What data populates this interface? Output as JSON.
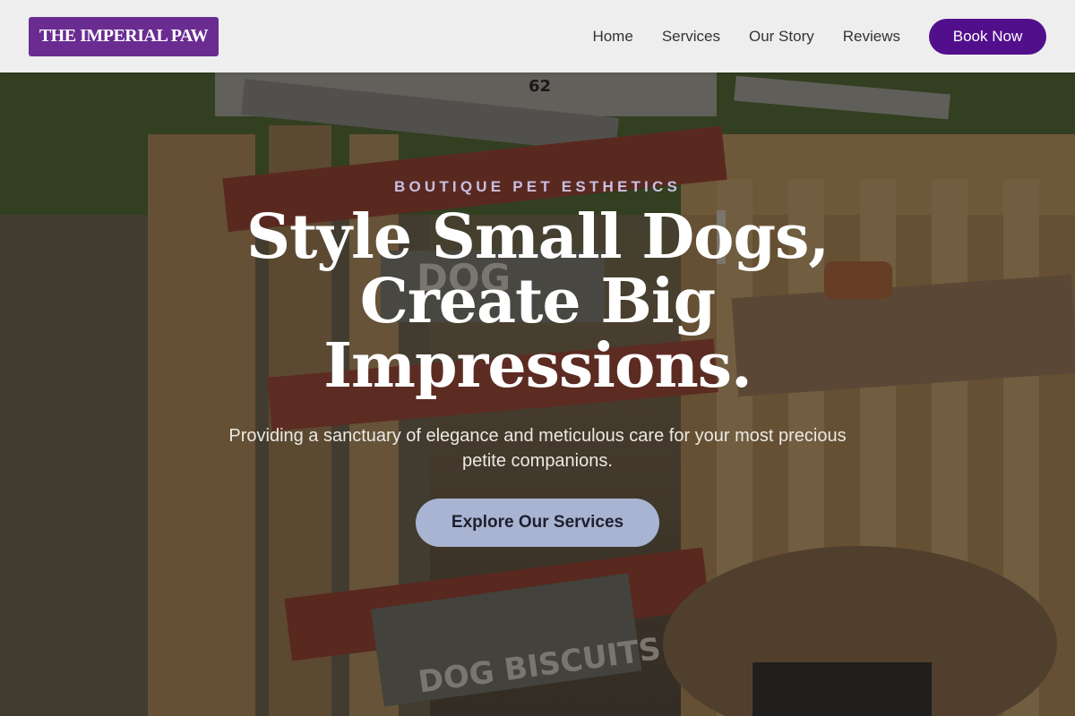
{
  "brand": {
    "logo_text": "THE IMPERIAL PAW"
  },
  "nav": {
    "items": [
      {
        "label": "Home"
      },
      {
        "label": "Services"
      },
      {
        "label": "Our Story"
      },
      {
        "label": "Reviews"
      }
    ],
    "cta_label": "Book Now"
  },
  "hero": {
    "eyebrow": "BOUTIQUE PET ESTHETICS",
    "title": "Style Small Dogs, Create Big Impressions.",
    "subtitle": "Providing a sanctuary of elegance and meticulous care for your most precious petite companions.",
    "cta_label": "Explore Our Services",
    "background_signs": [
      "62",
      "DOG",
      "DOG BISCUITS"
    ]
  },
  "colors": {
    "brand_purple": "#6a2c91",
    "book_button": "#520f8c",
    "cta_button": "#a8b4d1",
    "eyebrow": "#c9bfe0"
  }
}
